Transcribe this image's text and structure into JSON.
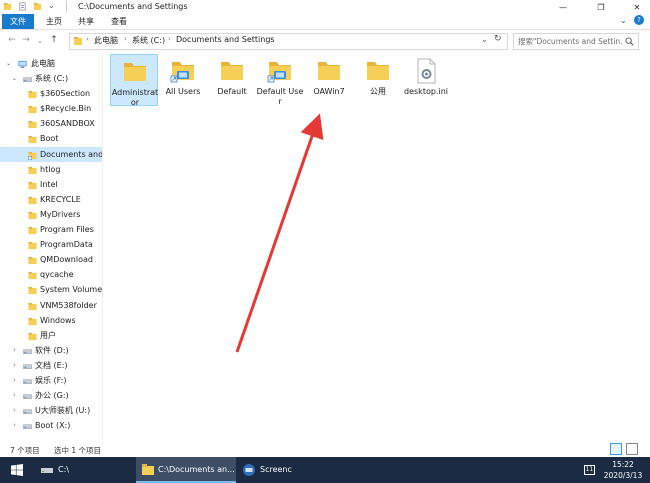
{
  "window": {
    "title": "C:\\Documents and Settings",
    "minimize": "—",
    "maximize": "❐",
    "close": "✕"
  },
  "ribbon": {
    "tabs": [
      "文件",
      "主页",
      "共享",
      "查看"
    ]
  },
  "address": {
    "back": "←",
    "forward": "→",
    "recent": "⌄",
    "up": "↑",
    "crumbs": [
      "此电脑",
      "系统 (C:)",
      "Documents and Settings"
    ],
    "dropdown": "⌄",
    "refresh": "↻",
    "search_placeholder": "搜索\"Documents and Settin..."
  },
  "nav": {
    "items": [
      {
        "label": "此电脑",
        "icon": "computer-icon"
      },
      {
        "label": "系统 (C:)",
        "icon": "drive-icon"
      },
      {
        "label": "$360Section",
        "icon": "folder-icon"
      },
      {
        "label": "$Recycle.Bin",
        "icon": "folder-icon"
      },
      {
        "label": "360SANDBOX",
        "icon": "folder-icon"
      },
      {
        "label": "Boot",
        "icon": "folder-icon"
      },
      {
        "label": "Documents and",
        "icon": "shortcut-folder-icon"
      },
      {
        "label": "htlog",
        "icon": "folder-icon"
      },
      {
        "label": "Intel",
        "icon": "folder-icon"
      },
      {
        "label": "KRECYCLE",
        "icon": "folder-icon"
      },
      {
        "label": "MyDrivers",
        "icon": "folder-icon"
      },
      {
        "label": "Program Files",
        "icon": "folder-icon"
      },
      {
        "label": "ProgramData",
        "icon": "folder-icon"
      },
      {
        "label": "QMDownload",
        "icon": "folder-icon"
      },
      {
        "label": "qycache",
        "icon": "folder-icon"
      },
      {
        "label": "System Volume I",
        "icon": "folder-icon"
      },
      {
        "label": "VNM538folder",
        "icon": "folder-icon"
      },
      {
        "label": "Windows",
        "icon": "folder-icon"
      },
      {
        "label": "用户",
        "icon": "folder-icon"
      },
      {
        "label": "软件 (D:)",
        "icon": "drive-icon"
      },
      {
        "label": "文档 (E:)",
        "icon": "drive-icon"
      },
      {
        "label": "娱乐 (F:)",
        "icon": "drive-icon"
      },
      {
        "label": "办公 (G:)",
        "icon": "drive-icon"
      },
      {
        "label": "U大师装机 (U:)",
        "icon": "drive-icon"
      },
      {
        "label": "Boot (X:)",
        "icon": "drive-icon"
      }
    ]
  },
  "files": [
    {
      "name": "Administrator",
      "icon": "folder-icon"
    },
    {
      "name": "All Users",
      "icon": "shortcut-folder-icon"
    },
    {
      "name": "Default",
      "icon": "folder-icon"
    },
    {
      "name": "Default User",
      "icon": "shortcut-folder-icon"
    },
    {
      "name": "OAWin7",
      "icon": "folder-icon"
    },
    {
      "name": "公用",
      "icon": "folder-icon"
    },
    {
      "name": "desktop.ini",
      "icon": "settings-file-icon"
    }
  ],
  "status": {
    "count": "7 个项目",
    "selected": "选中 1 个项目"
  },
  "taskbar": {
    "start": "windows-logo-icon",
    "items": [
      "C:\\",
      "C:\\Documents an...",
      "Screenc"
    ],
    "time": "15:22",
    "date": "2020/3/13"
  },
  "colors": {
    "accent": "#1979ca",
    "folder": "#f6cf57",
    "folder_dark": "#e8b53c",
    "selection": "#cce8ff",
    "taskbar": "#1a2b43",
    "arrow": "#e53935"
  }
}
